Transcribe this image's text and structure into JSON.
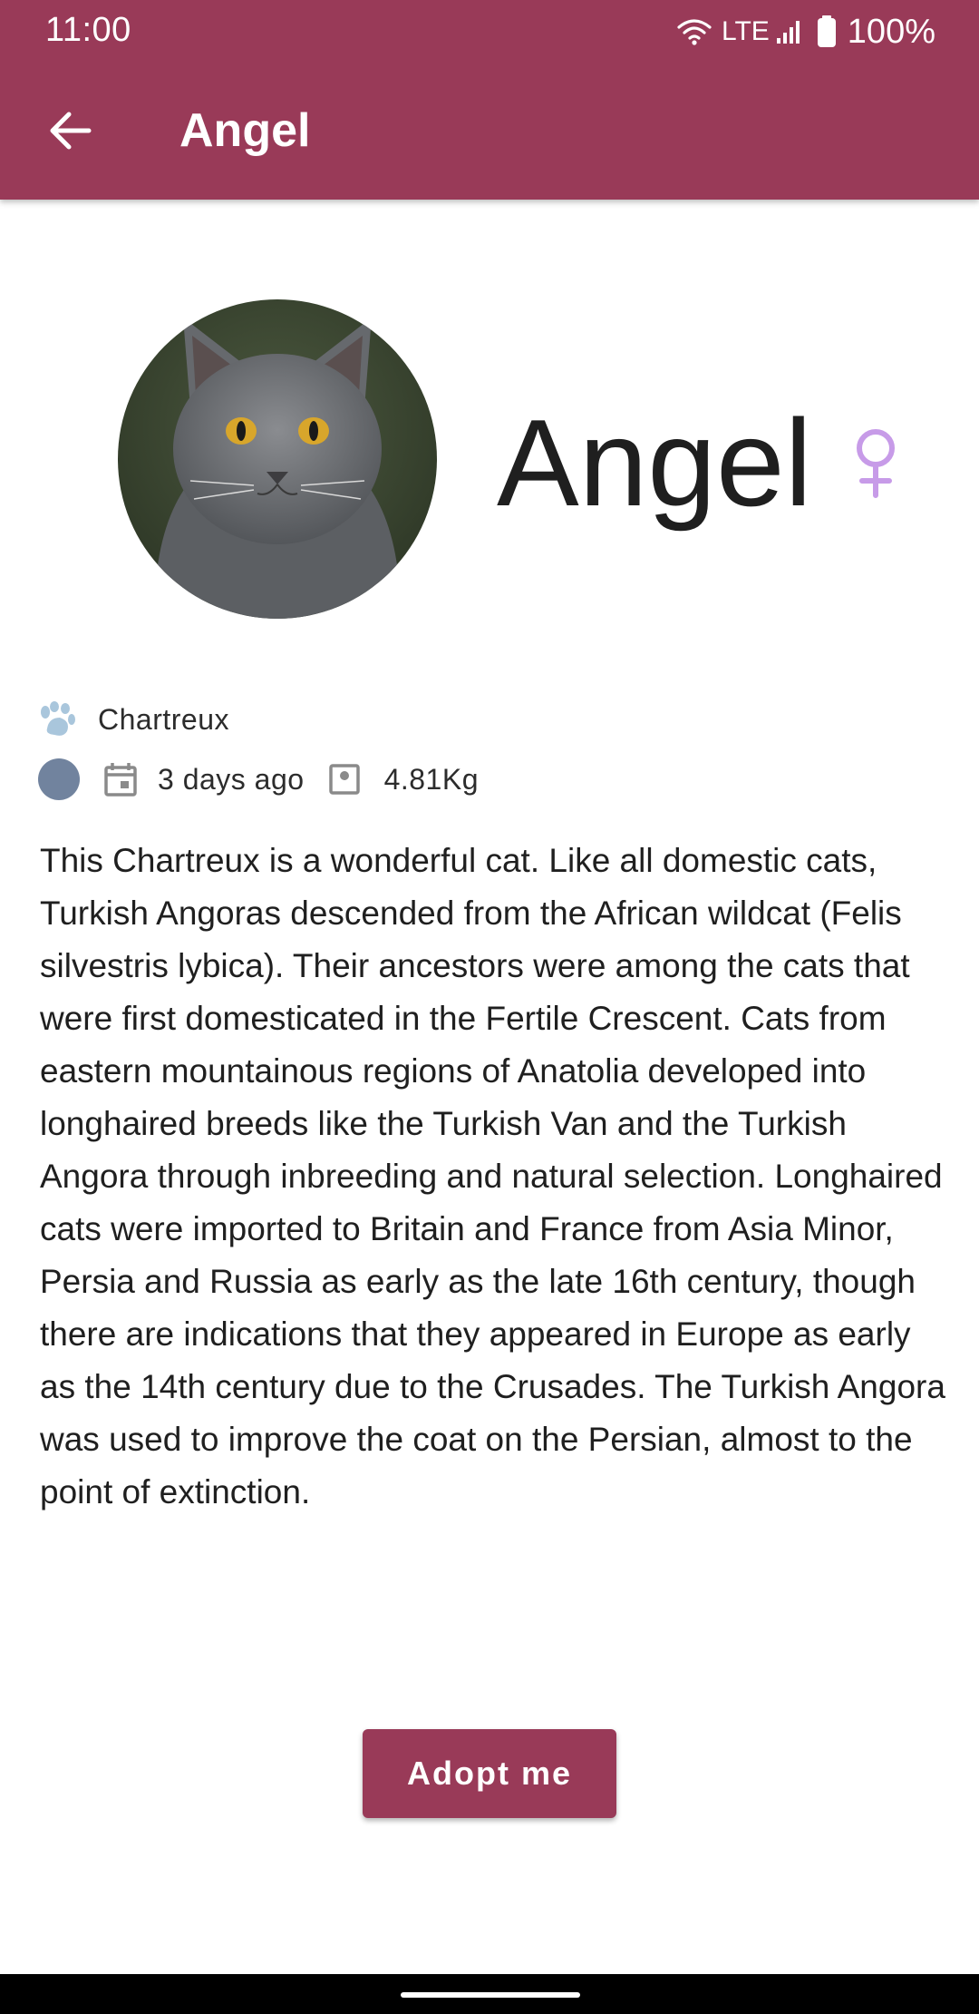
{
  "status_bar": {
    "time": "11:00",
    "network": "LTE",
    "battery": "100%",
    "icons": [
      "wifi-icon",
      "signal-icon",
      "battery-icon"
    ]
  },
  "toolbar": {
    "title": "Angel",
    "back_icon": "arrow-back-icon"
  },
  "pet": {
    "name": "Angel",
    "gender_icon": "female-icon",
    "breed": "Chartreux",
    "breed_icon": "paw-icon",
    "color": "#71839e",
    "age": "3 days ago",
    "age_icon": "calendar-icon",
    "weight": "4.81Kg",
    "weight_icon": "scale-icon",
    "description": "This Chartreux is a wonderful cat. Like all domestic cats, Turkish Angoras descended from the African wildcat (Felis silvestris lybica). Their ancestors were among the cats that were first domesticated in the Fertile Crescent. Cats from eastern mountainous regions of Anatolia developed into longhaired breeds like the Turkish Van and the Turkish Angora through inbreeding and natural selection. Longhaired cats were imported to Britain and France from Asia Minor, Persia and Russia as early as the late 16th century, though there are indications that they appeared in Europe as early as the 14th century due to the Crusades. The Turkish Angora was used to improve the coat on the Persian, almost to the point of extinction."
  },
  "actions": {
    "adopt_label": "Adopt me"
  },
  "colors": {
    "primary": "#993a58",
    "gender_female": "#c79be8",
    "icon_gray": "#8a8a8a",
    "breed_icon": "#a9c6dc"
  }
}
